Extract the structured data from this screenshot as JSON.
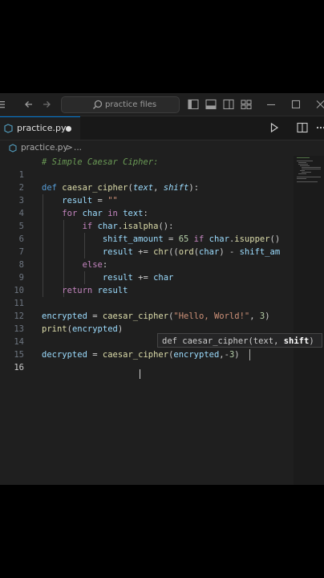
{
  "titlebar": {
    "search_placeholder": "practice files",
    "icons": [
      "menu-icon",
      "back-arrow-icon",
      "forward-arrow-icon",
      "search-icon",
      "toggle-primary-sidebar-icon",
      "toggle-panel-icon",
      "toggle-secondary-sidebar-icon",
      "customize-layout-icon",
      "minimize-icon",
      "maximize-icon",
      "close-icon"
    ]
  },
  "tab": {
    "filename": "practice.py",
    "modified": true
  },
  "tab_actions": [
    "run-icon",
    "split-editor-icon",
    "more-actions-icon"
  ],
  "breadcrumb": {
    "file": "practice.py",
    "separator": ">",
    "more": "..."
  },
  "editor": {
    "active_line": 16,
    "lines": [
      {
        "n": "1",
        "text": "# Simple Caesar Cipher:"
      },
      {
        "n": "2",
        "text": ""
      },
      {
        "n": "3",
        "text": "def caesar_cipher(text, shift):"
      },
      {
        "n": "4",
        "text": "    result = \"\""
      },
      {
        "n": "5",
        "text": "    for char in text:"
      },
      {
        "n": "6",
        "text": "        if char.isalpha():"
      },
      {
        "n": "7",
        "text": "            shift_amount = 65 if char.isupper()"
      },
      {
        "n": "8",
        "text": "            result += chr((ord(char) - shift_am"
      },
      {
        "n": "9",
        "text": "        else:"
      },
      {
        "n": "10",
        "text": "            result += char"
      },
      {
        "n": "11",
        "text": "    return result"
      },
      {
        "n": "12",
        "text": ""
      },
      {
        "n": "13",
        "text": "encrypted = caesar_cipher(\"Hello, World!\", 3)"
      },
      {
        "n": "14",
        "text": "print(encrypted)"
      },
      {
        "n": "15",
        "text": ""
      },
      {
        "n": "16",
        "text": "decrypted = caesar_cipher(encrypted,-3)"
      }
    ]
  },
  "tooltip": {
    "prefix": "def caesar_cipher(text, ",
    "highlight": "shift",
    "suffix": ")"
  },
  "colors": {
    "keyword": "#569cd6",
    "control": "#c586c0",
    "function": "#dcdcaa",
    "string": "#ce9178",
    "number": "#b5cea8",
    "comment": "#6a9955",
    "accent": "#0078d4"
  }
}
